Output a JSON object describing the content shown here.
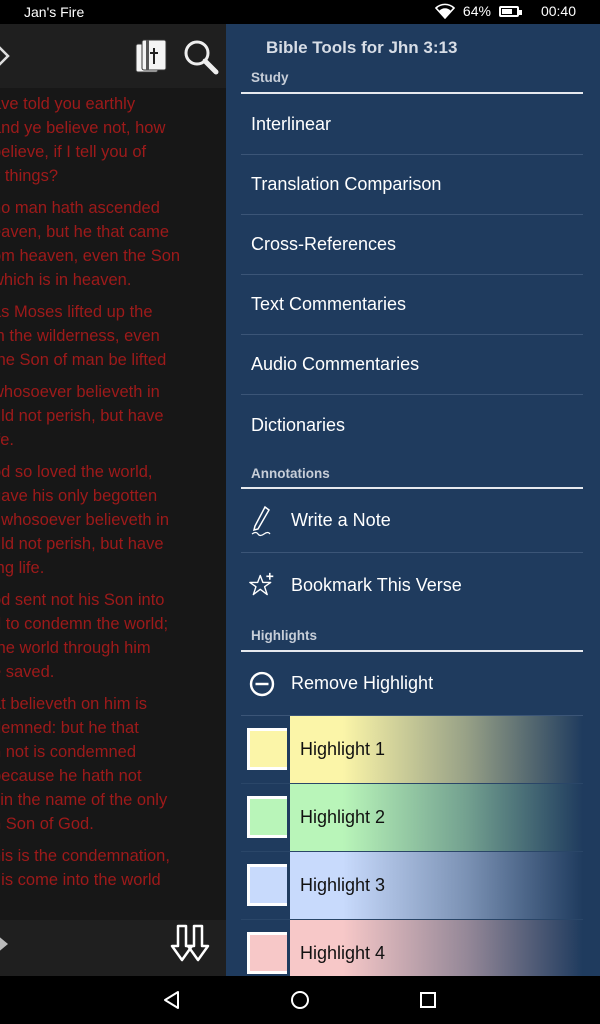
{
  "status_bar": {
    "carrier": "Jan's Fire",
    "battery": "64%",
    "time": "00:40"
  },
  "reader": {
    "verses": [
      [
        "ave told you earthly",
        "and ye believe not, how",
        "believe, if I tell you of",
        "y things?"
      ],
      [
        "no man hath ascended",
        "eaven, but he that came",
        "om heaven, even the Son",
        "which is in heaven."
      ],
      [
        "as Moses lifted up the",
        "in the wilderness, even",
        "the Son of man be lifted"
      ],
      [
        "whosoever believeth in",
        "uld not perish, but have",
        "ife."
      ],
      [
        "od so loved the world,",
        "gave his only begotten",
        "t whosoever believeth in",
        "uld not perish, but have",
        "ing life."
      ],
      [
        "od sent not his Son into",
        "d to condemn the world;",
        "the world through him",
        "e saved."
      ],
      [
        "at believeth on him is",
        "demned: but he that",
        "h not is condemned",
        "because he hath not",
        "l in the name of the only",
        "n Son of God."
      ],
      [
        "his is the condemnation,",
        "t is come into the world"
      ]
    ]
  },
  "drawer": {
    "title": "Bible Tools for Jhn 3:13",
    "sections": {
      "study": "Study",
      "annotations": "Annotations",
      "highlights": "Highlights"
    },
    "study_items": [
      "Interlinear",
      "Translation Comparison",
      "Cross-References",
      "Text Commentaries",
      "Audio Commentaries",
      "Dictionaries"
    ],
    "annotation_items": [
      {
        "label": "Write a Note",
        "icon": "pen-icon"
      },
      {
        "label": "Bookmark This Verse",
        "icon": "star-plus-icon"
      }
    ],
    "remove_highlight": {
      "label": "Remove Highlight",
      "icon": "minus-circle-icon"
    },
    "highlights": [
      {
        "label": "Highlight 1",
        "color": "#fbf5a8"
      },
      {
        "label": "Highlight 2",
        "color": "#b9f5b9"
      },
      {
        "label": "Highlight 3",
        "color": "#c8dafc"
      },
      {
        "label": "Highlight 4",
        "color": "#f7c8c8"
      }
    ]
  },
  "colors": {
    "drawer_bg": "#1f3b5e",
    "verse_text": "#9e1a1a",
    "reader_bg": "#171717"
  }
}
